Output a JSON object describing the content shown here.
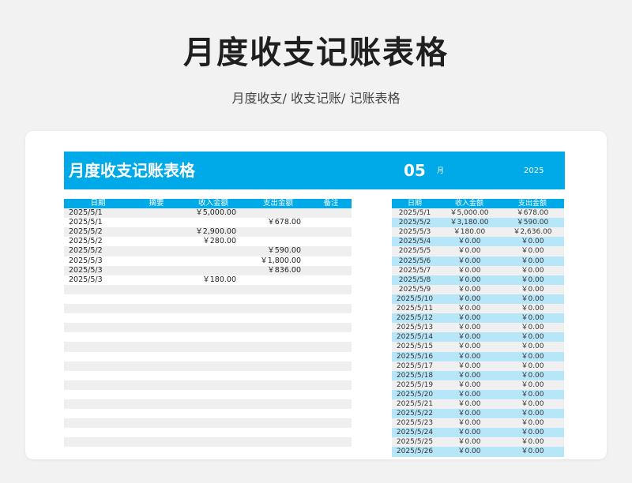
{
  "header": {
    "title": "月度收支记账表格",
    "breadcrumb": "月度收支/  收支记账/  记账表格"
  },
  "sheet": {
    "banner": {
      "title": "月度收支记账表格",
      "month": "05",
      "month_label": "月",
      "year": "2025"
    },
    "ledger": {
      "columns": [
        "日期",
        "摘要",
        "收入金额",
        "支出金额",
        "备注"
      ],
      "rows": [
        [
          "2025/5/1",
          "",
          "￥5,000.00",
          "",
          ""
        ],
        [
          "2025/5/1",
          "",
          "",
          "￥678.00",
          ""
        ],
        [
          "2025/5/2",
          "",
          "￥2,900.00",
          "",
          ""
        ],
        [
          "2025/5/2",
          "",
          "￥280.00",
          "",
          ""
        ],
        [
          "2025/5/2",
          "",
          "",
          "￥590.00",
          ""
        ],
        [
          "2025/5/3",
          "",
          "",
          "￥1,800.00",
          ""
        ],
        [
          "2025/5/3",
          "",
          "",
          "￥836.00",
          ""
        ],
        [
          "2025/5/3",
          "",
          "￥180.00",
          "",
          ""
        ],
        [
          "",
          "",
          "",
          "",
          ""
        ],
        [
          "",
          "",
          "",
          "",
          ""
        ],
        [
          "",
          "",
          "",
          "",
          ""
        ],
        [
          "",
          "",
          "",
          "",
          ""
        ],
        [
          "",
          "",
          "",
          "",
          ""
        ],
        [
          "",
          "",
          "",
          "",
          ""
        ],
        [
          "",
          "",
          "",
          "",
          ""
        ],
        [
          "",
          "",
          "",
          "",
          ""
        ],
        [
          "",
          "",
          "",
          "",
          ""
        ],
        [
          "",
          "",
          "",
          "",
          ""
        ],
        [
          "",
          "",
          "",
          "",
          ""
        ],
        [
          "",
          "",
          "",
          "",
          ""
        ],
        [
          "",
          "",
          "",
          "",
          ""
        ],
        [
          "",
          "",
          "",
          "",
          ""
        ],
        [
          "",
          "",
          "",
          "",
          ""
        ],
        [
          "",
          "",
          "",
          "",
          ""
        ],
        [
          "",
          "",
          "",
          "",
          ""
        ],
        [
          "",
          "",
          "",
          "",
          ""
        ]
      ]
    },
    "daily_summary": {
      "columns": [
        "日期",
        "收入金额",
        "支出金额"
      ],
      "rows": [
        [
          "2025/5/1",
          "￥5,000.00",
          "￥678.00"
        ],
        [
          "2025/5/2",
          "￥3,180.00",
          "￥590.00"
        ],
        [
          "2025/5/3",
          "￥180.00",
          "￥2,636.00"
        ],
        [
          "2025/5/4",
          "￥0.00",
          "￥0.00"
        ],
        [
          "2025/5/5",
          "￥0.00",
          "￥0.00"
        ],
        [
          "2025/5/6",
          "￥0.00",
          "￥0.00"
        ],
        [
          "2025/5/7",
          "￥0.00",
          "￥0.00"
        ],
        [
          "2025/5/8",
          "￥0.00",
          "￥0.00"
        ],
        [
          "2025/5/9",
          "￥0.00",
          "￥0.00"
        ],
        [
          "2025/5/10",
          "￥0.00",
          "￥0.00"
        ],
        [
          "2025/5/11",
          "￥0.00",
          "￥0.00"
        ],
        [
          "2025/5/12",
          "￥0.00",
          "￥0.00"
        ],
        [
          "2025/5/13",
          "￥0.00",
          "￥0.00"
        ],
        [
          "2025/5/14",
          "￥0.00",
          "￥0.00"
        ],
        [
          "2025/5/15",
          "￥0.00",
          "￥0.00"
        ],
        [
          "2025/5/16",
          "￥0.00",
          "￥0.00"
        ],
        [
          "2025/5/17",
          "￥0.00",
          "￥0.00"
        ],
        [
          "2025/5/18",
          "￥0.00",
          "￥0.00"
        ],
        [
          "2025/5/19",
          "￥0.00",
          "￥0.00"
        ],
        [
          "2025/5/20",
          "￥0.00",
          "￥0.00"
        ],
        [
          "2025/5/21",
          "￥0.00",
          "￥0.00"
        ],
        [
          "2025/5/22",
          "￥0.00",
          "￥0.00"
        ],
        [
          "2025/5/23",
          "￥0.00",
          "￥0.00"
        ],
        [
          "2025/5/24",
          "￥0.00",
          "￥0.00"
        ],
        [
          "2025/5/25",
          "￥0.00",
          "￥0.00"
        ],
        [
          "2025/5/26",
          "￥0.00",
          "￥0.00"
        ]
      ]
    }
  },
  "colors": {
    "accent": "#00a9e8",
    "summary_row_alt": "#b7e6f8",
    "ledger_row_alt": "#efefef"
  }
}
